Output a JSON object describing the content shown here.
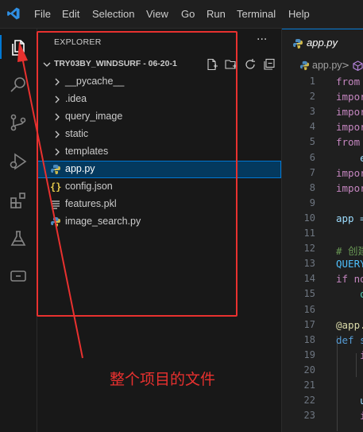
{
  "menubar": {
    "items": [
      "File",
      "Edit",
      "Selection",
      "View",
      "Go",
      "Run",
      "Terminal",
      "Help"
    ]
  },
  "activity_bar": {
    "icons": [
      "explorer-icon",
      "search-icon",
      "source-control-icon",
      "run-debug-icon",
      "extensions-icon",
      "testing-icon",
      "remote-explorer-icon"
    ],
    "active": "explorer-icon"
  },
  "sidebar": {
    "title": "EXPLORER",
    "more": "···",
    "folder_name": "TRY03BY_WINDSURF - 06-20-1",
    "actions": [
      "new-file-icon",
      "new-folder-icon",
      "refresh-icon",
      "collapse-all-icon"
    ],
    "tree": [
      {
        "label": "__pycache__",
        "kind": "folder"
      },
      {
        "label": ".idea",
        "kind": "folder"
      },
      {
        "label": "query_image",
        "kind": "folder"
      },
      {
        "label": "static",
        "kind": "folder"
      },
      {
        "label": "templates",
        "kind": "folder"
      },
      {
        "label": "app.py",
        "kind": "python",
        "selected": true
      },
      {
        "label": "config.json",
        "kind": "json"
      },
      {
        "label": "features.pkl",
        "kind": "pkl"
      },
      {
        "label": "image_search.py",
        "kind": "python"
      }
    ]
  },
  "editor": {
    "tab_label": "app.py",
    "breadcrumb_file": "app.py",
    "breadcrumb_sep": ">",
    "lines": [
      {
        "n": "1",
        "text": "from",
        "color": "#c586c0"
      },
      {
        "n": "2",
        "text": "impor",
        "color": "#c586c0"
      },
      {
        "n": "3",
        "text": "impor",
        "color": "#c586c0"
      },
      {
        "n": "4",
        "text": "impor",
        "color": "#c586c0"
      },
      {
        "n": "5",
        "text": "from",
        "color": "#c586c0"
      },
      {
        "n": "6",
        "text": "    e",
        "color": "#9cdcfe"
      },
      {
        "n": "7",
        "text": "impor",
        "color": "#c586c0"
      },
      {
        "n": "8",
        "text": "impor",
        "color": "#c586c0"
      },
      {
        "n": "9",
        "text": "",
        "color": "#cccccc"
      },
      {
        "n": "10",
        "text": "app =",
        "color": "#9cdcfe"
      },
      {
        "n": "11",
        "text": "",
        "color": "#cccccc"
      },
      {
        "n": "12",
        "text": "# 创建",
        "color": "#6a9955"
      },
      {
        "n": "13",
        "text": "QUERY",
        "color": "#4fc1ff"
      },
      {
        "n": "14",
        "text": "if no",
        "color": "#c586c0"
      },
      {
        "n": "15",
        "text": "    o",
        "color": "#4ec9b0"
      },
      {
        "n": "16",
        "text": "",
        "color": "#cccccc"
      },
      {
        "n": "17",
        "text": "@app.",
        "color": "#dcdcaa"
      },
      {
        "n": "18",
        "text": "def s",
        "color": "#569cd6"
      },
      {
        "n": "19",
        "text": "    i",
        "color": "#c586c0"
      },
      {
        "n": "20",
        "text": "",
        "color": "#cccccc"
      },
      {
        "n": "21",
        "text": "",
        "color": "#cccccc"
      },
      {
        "n": "22",
        "text": "    u",
        "color": "#9cdcfe"
      },
      {
        "n": "23",
        "text": "    i",
        "color": "#c586c0"
      }
    ]
  },
  "annotation": {
    "text": "整个项目的文件",
    "color": "#e8312f"
  }
}
